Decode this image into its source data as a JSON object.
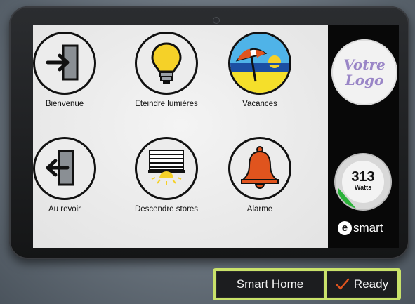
{
  "tiles": [
    {
      "label": "Bienvenue",
      "icon": "door-enter-icon"
    },
    {
      "label": "Eteindre lumières",
      "icon": "light-bulb-icon"
    },
    {
      "label": "Vacances",
      "icon": "beach-umbrella-icon"
    },
    {
      "label": "Au revoir",
      "icon": "door-exit-icon"
    },
    {
      "label": "Descendre stores",
      "icon": "blinds-icon"
    },
    {
      "label": "Alarme",
      "icon": "bell-icon"
    }
  ],
  "logo": {
    "line1": "Votre",
    "line2": "Logo"
  },
  "power": {
    "value": "313",
    "unit": "Watts"
  },
  "brand": {
    "badge": "e",
    "name": "smart"
  },
  "status": {
    "app_name": "Smart Home",
    "state": "Ready"
  },
  "colors": {
    "accent": "#c9e26a",
    "bulb": "#f5d128",
    "bell": "#e0541e",
    "gauge_arc": "#2bb23a",
    "check": "#e0541e"
  }
}
